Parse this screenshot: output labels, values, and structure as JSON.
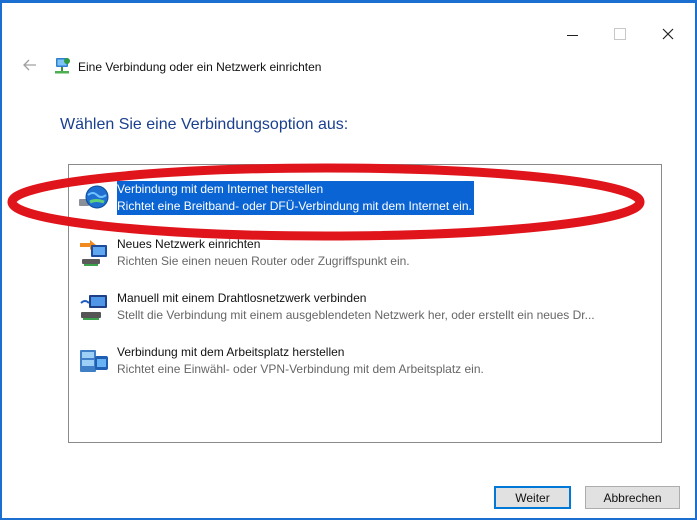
{
  "window": {
    "title": "Eine Verbindung oder ein Netzwerk einrichten",
    "minimize_label": "Minimize",
    "maximize_label": "Maximize",
    "close_label": "Close",
    "back_label": "Back"
  },
  "main": {
    "heading": "Wählen Sie eine Verbindungsoption aus:",
    "options": [
      {
        "title": "Verbindung mit dem Internet herstellen",
        "description": "Richtet eine Breitband- oder DFÜ-Verbindung mit dem Internet ein.",
        "icon": "globe-network-icon",
        "selected": true
      },
      {
        "title": "Neues Netzwerk einrichten",
        "description": "Richten Sie einen neuen Router oder Zugriffspunkt ein.",
        "icon": "router-setup-icon",
        "selected": false
      },
      {
        "title": "Manuell mit einem Drahtlosnetzwerk verbinden",
        "description": "Stellt die Verbindung mit einem ausgeblendeten Netzwerk her, oder erstellt ein neues Dr...",
        "icon": "wireless-network-icon",
        "selected": false
      },
      {
        "title": "Verbindung mit dem Arbeitsplatz herstellen",
        "description": "Richtet eine Einwähl- oder VPN-Verbindung mit dem Arbeitsplatz ein.",
        "icon": "workplace-vpn-icon",
        "selected": false
      }
    ]
  },
  "footer": {
    "next_label": "Weiter",
    "cancel_label": "Abbrechen"
  },
  "colors": {
    "accent": "#0a64d3",
    "heading": "#1a3f8f",
    "annotation": "#e0141b",
    "frame": "#1b6fd1"
  }
}
